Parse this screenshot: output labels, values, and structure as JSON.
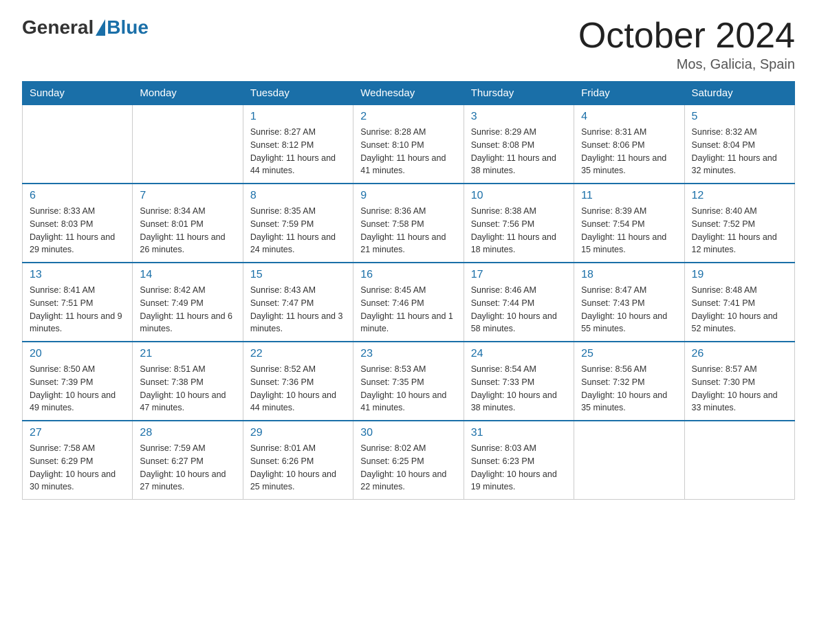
{
  "header": {
    "logo_general": "General",
    "logo_blue": "Blue",
    "title": "October 2024",
    "subtitle": "Mos, Galicia, Spain"
  },
  "days_of_week": [
    "Sunday",
    "Monday",
    "Tuesday",
    "Wednesday",
    "Thursday",
    "Friday",
    "Saturday"
  ],
  "weeks": [
    [
      {
        "day": "",
        "info": ""
      },
      {
        "day": "",
        "info": ""
      },
      {
        "day": "1",
        "info": "Sunrise: 8:27 AM\nSunset: 8:12 PM\nDaylight: 11 hours\nand 44 minutes."
      },
      {
        "day": "2",
        "info": "Sunrise: 8:28 AM\nSunset: 8:10 PM\nDaylight: 11 hours\nand 41 minutes."
      },
      {
        "day": "3",
        "info": "Sunrise: 8:29 AM\nSunset: 8:08 PM\nDaylight: 11 hours\nand 38 minutes."
      },
      {
        "day": "4",
        "info": "Sunrise: 8:31 AM\nSunset: 8:06 PM\nDaylight: 11 hours\nand 35 minutes."
      },
      {
        "day": "5",
        "info": "Sunrise: 8:32 AM\nSunset: 8:04 PM\nDaylight: 11 hours\nand 32 minutes."
      }
    ],
    [
      {
        "day": "6",
        "info": "Sunrise: 8:33 AM\nSunset: 8:03 PM\nDaylight: 11 hours\nand 29 minutes."
      },
      {
        "day": "7",
        "info": "Sunrise: 8:34 AM\nSunset: 8:01 PM\nDaylight: 11 hours\nand 26 minutes."
      },
      {
        "day": "8",
        "info": "Sunrise: 8:35 AM\nSunset: 7:59 PM\nDaylight: 11 hours\nand 24 minutes."
      },
      {
        "day": "9",
        "info": "Sunrise: 8:36 AM\nSunset: 7:58 PM\nDaylight: 11 hours\nand 21 minutes."
      },
      {
        "day": "10",
        "info": "Sunrise: 8:38 AM\nSunset: 7:56 PM\nDaylight: 11 hours\nand 18 minutes."
      },
      {
        "day": "11",
        "info": "Sunrise: 8:39 AM\nSunset: 7:54 PM\nDaylight: 11 hours\nand 15 minutes."
      },
      {
        "day": "12",
        "info": "Sunrise: 8:40 AM\nSunset: 7:52 PM\nDaylight: 11 hours\nand 12 minutes."
      }
    ],
    [
      {
        "day": "13",
        "info": "Sunrise: 8:41 AM\nSunset: 7:51 PM\nDaylight: 11 hours\nand 9 minutes."
      },
      {
        "day": "14",
        "info": "Sunrise: 8:42 AM\nSunset: 7:49 PM\nDaylight: 11 hours\nand 6 minutes."
      },
      {
        "day": "15",
        "info": "Sunrise: 8:43 AM\nSunset: 7:47 PM\nDaylight: 11 hours\nand 3 minutes."
      },
      {
        "day": "16",
        "info": "Sunrise: 8:45 AM\nSunset: 7:46 PM\nDaylight: 11 hours\nand 1 minute."
      },
      {
        "day": "17",
        "info": "Sunrise: 8:46 AM\nSunset: 7:44 PM\nDaylight: 10 hours\nand 58 minutes."
      },
      {
        "day": "18",
        "info": "Sunrise: 8:47 AM\nSunset: 7:43 PM\nDaylight: 10 hours\nand 55 minutes."
      },
      {
        "day": "19",
        "info": "Sunrise: 8:48 AM\nSunset: 7:41 PM\nDaylight: 10 hours\nand 52 minutes."
      }
    ],
    [
      {
        "day": "20",
        "info": "Sunrise: 8:50 AM\nSunset: 7:39 PM\nDaylight: 10 hours\nand 49 minutes."
      },
      {
        "day": "21",
        "info": "Sunrise: 8:51 AM\nSunset: 7:38 PM\nDaylight: 10 hours\nand 47 minutes."
      },
      {
        "day": "22",
        "info": "Sunrise: 8:52 AM\nSunset: 7:36 PM\nDaylight: 10 hours\nand 44 minutes."
      },
      {
        "day": "23",
        "info": "Sunrise: 8:53 AM\nSunset: 7:35 PM\nDaylight: 10 hours\nand 41 minutes."
      },
      {
        "day": "24",
        "info": "Sunrise: 8:54 AM\nSunset: 7:33 PM\nDaylight: 10 hours\nand 38 minutes."
      },
      {
        "day": "25",
        "info": "Sunrise: 8:56 AM\nSunset: 7:32 PM\nDaylight: 10 hours\nand 35 minutes."
      },
      {
        "day": "26",
        "info": "Sunrise: 8:57 AM\nSunset: 7:30 PM\nDaylight: 10 hours\nand 33 minutes."
      }
    ],
    [
      {
        "day": "27",
        "info": "Sunrise: 7:58 AM\nSunset: 6:29 PM\nDaylight: 10 hours\nand 30 minutes."
      },
      {
        "day": "28",
        "info": "Sunrise: 7:59 AM\nSunset: 6:27 PM\nDaylight: 10 hours\nand 27 minutes."
      },
      {
        "day": "29",
        "info": "Sunrise: 8:01 AM\nSunset: 6:26 PM\nDaylight: 10 hours\nand 25 minutes."
      },
      {
        "day": "30",
        "info": "Sunrise: 8:02 AM\nSunset: 6:25 PM\nDaylight: 10 hours\nand 22 minutes."
      },
      {
        "day": "31",
        "info": "Sunrise: 8:03 AM\nSunset: 6:23 PM\nDaylight: 10 hours\nand 19 minutes."
      },
      {
        "day": "",
        "info": ""
      },
      {
        "day": "",
        "info": ""
      }
    ]
  ]
}
